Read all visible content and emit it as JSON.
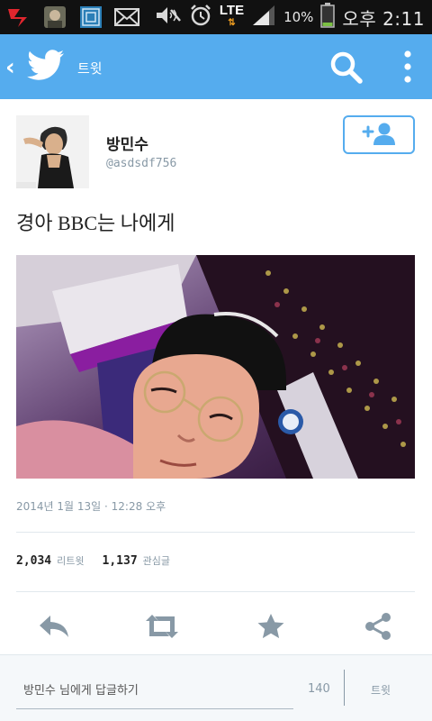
{
  "status_bar": {
    "network": "LTE",
    "battery_percent": "10%",
    "clock": "오후 2:11",
    "icons": [
      "notification-app-icon",
      "avatar-notification-icon",
      "grid-app-icon",
      "mail-icon",
      "mute-icon",
      "alarm-icon",
      "lte-icon",
      "signal-icon",
      "battery-icon"
    ]
  },
  "appbar": {
    "title": "트윗",
    "back_icon": "back-icon",
    "logo_icon": "twitter-bird-icon",
    "search_icon": "search-icon",
    "more_icon": "more-vertical-icon"
  },
  "tweet": {
    "user_name": "방민수",
    "user_handle": "@asdsdf756",
    "text": "경아 BBC는 나에게",
    "timestamp": "2014년 1월 13일 · 12:28 오후",
    "retweets_count": "2,034",
    "retweets_label": "리트윗",
    "favorites_count": "1,137",
    "favorites_label": "관심글",
    "follow_icon": "add-user-icon"
  },
  "actions": {
    "reply_icon": "reply-icon",
    "retweet_icon": "retweet-icon",
    "favorite_icon": "star-icon",
    "share_icon": "share-icon"
  },
  "reply_bar": {
    "placeholder": "방민수 님에게 답글하기",
    "char_count": "140",
    "tweet_button": "트윗"
  },
  "colors": {
    "brand": "#55acee",
    "status_bar": "#111111",
    "muted_text": "#8899a6",
    "icon_gray": "#8899a6"
  }
}
